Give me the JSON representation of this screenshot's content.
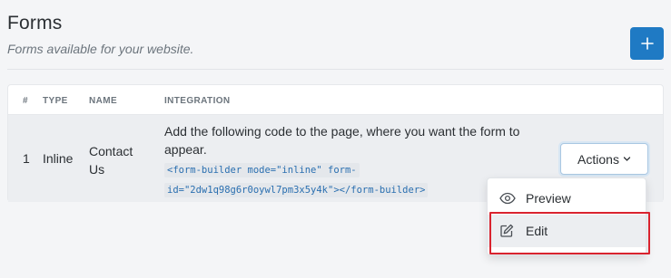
{
  "header": {
    "title": "Forms",
    "subtitle": "Forms available for your website."
  },
  "add_button": {
    "icon": "plus-icon",
    "color": "#1f7ac4"
  },
  "table": {
    "columns": [
      "#",
      "TYPE",
      "NAME",
      "INTEGRATION"
    ],
    "rows": [
      {
        "index": "1",
        "type": "Inline",
        "name_line1": "Contact",
        "name_line2": "Us",
        "integration_text": "Add the following code to the page, where you want the form to appear.",
        "integration_code": "<form-builder mode=\"inline\" form-id=\"2dw1q98g6r0oywl7pm3x5y4k\"></form-builder>",
        "actions_label": "Actions"
      }
    ]
  },
  "actions_menu": {
    "items": [
      {
        "label": "Preview",
        "icon": "eye-icon"
      },
      {
        "label": "Edit",
        "icon": "edit-icon"
      }
    ]
  },
  "colors": {
    "accent": "#1f7ac4",
    "highlight": "#d9232e",
    "code": "#2a6fb0"
  }
}
